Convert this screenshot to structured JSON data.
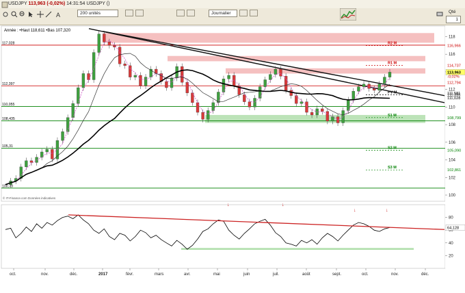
{
  "toolbar": {
    "symbol": "USDJPY",
    "last": "113,963",
    "change": "(-0,02%)",
    "time": "14:31:54",
    "symbol_suffix": "USDJPY ()",
    "units_label": "200 unités",
    "journal_label": "Journalier",
    "qty_label": "Qté",
    "qty_value": "1"
  },
  "legend": {
    "text": "Année : •Haut 118,611 •Bas 107,320"
  },
  "chart_data": {
    "type": "line",
    "subtype": "candlestick with moving averages, support/resistance zones, pivot levels and lower oscillator",
    "x_ticks": [
      "oct.",
      "nov.",
      "déc.",
      "2017",
      "févr.",
      "mars",
      "avr.",
      "mai",
      "juin",
      "juil.",
      "août",
      "sept.",
      "oct.",
      "nov.",
      "déc."
    ],
    "y_ticks": [
      100,
      102,
      104,
      106,
      108,
      110,
      112,
      114,
      116,
      118
    ],
    "ylim": [
      99.3,
      119.2
    ],
    "left_levels": [
      {
        "label": "117,028",
        "value": 117.03,
        "color": "#cc0000"
      },
      {
        "label": "112,397",
        "value": 112.4,
        "color": "#cc0000"
      },
      {
        "label": "110,055",
        "value": 110.06,
        "color": "#008000"
      },
      {
        "label": "108,435",
        "value": 108.44,
        "color": "#008000"
      },
      {
        "label": "105,31",
        "value": 105.31,
        "color": "#008000"
      },
      {
        "label": "100,79",
        "value": 100.79,
        "color": "#008000"
      }
    ],
    "right_labels": [
      {
        "label": "116,966",
        "value": 116.97,
        "color": "#cc0000"
      },
      {
        "label": "114,737",
        "value": 114.74,
        "color": "#cc0000"
      },
      {
        "label": "113,963",
        "value": 113.96,
        "color": "#000000",
        "box": "#ffff66"
      },
      {
        "label": "-0,02%",
        "value": 113.5,
        "color": "#cc0000"
      },
      {
        "label": "112,794",
        "value": 112.79,
        "color": "#cc0000"
      },
      {
        "label": "111,581",
        "value": 111.58,
        "color": "#000000"
      },
      {
        "label": "111,395",
        "value": 111.4,
        "color": "#000000"
      },
      {
        "label": "111,028",
        "value": 111.03,
        "color": "#000000"
      },
      {
        "label": "108,799",
        "value": 108.8,
        "color": "#008000"
      },
      {
        "label": "105,090",
        "value": 105.09,
        "color": "#008000"
      },
      {
        "label": "102,861",
        "value": 102.86,
        "color": "#008000"
      }
    ],
    "pivots": [
      {
        "label": "R2 M",
        "value": 116.97,
        "color": "#cc0000"
      },
      {
        "label": "R1 M",
        "value": 114.74,
        "color": "#cc0000"
      },
      {
        "label": "PV M",
        "value": 111.4,
        "color": "#000000"
      },
      {
        "label": "S1 M",
        "value": 108.8,
        "color": "#008000"
      },
      {
        "label": "S2 M",
        "value": 105.09,
        "color": "#008000"
      },
      {
        "label": "S3 M",
        "value": 102.86,
        "color": "#008000"
      }
    ],
    "zones": [
      {
        "from": 117.3,
        "to": 118.4,
        "color": "#f4b9b9"
      },
      {
        "from": 115.2,
        "to": 115.8,
        "color": "#f4b9b9"
      },
      {
        "from": 113.8,
        "to": 114.4,
        "color": "#f4b9b9"
      },
      {
        "from": 108.2,
        "to": 109.1,
        "color": "#b5e0b0"
      }
    ],
    "price": [
      101.2,
      101.6,
      101.9,
      103.2,
      103.9,
      103.7,
      104.3,
      104.9,
      105.2,
      104.1,
      106.2,
      107.2,
      108.8,
      110.4,
      112.2,
      113.8,
      113.1,
      116.2,
      118.3,
      117.4,
      117.0,
      116.8,
      114.9,
      114.7,
      113.4,
      113.6,
      112.4,
      113.4,
      114.3,
      113.8,
      112.9,
      112.2,
      113.3,
      114.6,
      112.8,
      111.6,
      110.5,
      109.4,
      108.6,
      109.6,
      110.5,
      111.7,
      113.2,
      113.6,
      112.4,
      111.4,
      110.6,
      110.0,
      111.0,
      112.3,
      113.1,
      113.7,
      114.3,
      113.5,
      111.9,
      111.3,
      110.4,
      110.6,
      109.4,
      109.1,
      109.8,
      109.5,
      108.4,
      108.9,
      108.2,
      109.6,
      110.8,
      111.8,
      112.3,
      112.6,
      112.1,
      111.9,
      112.6,
      113.4,
      113.96
    ],
    "oscillator_ticks": [
      20,
      40,
      60,
      80
    ],
    "oscillator_label": "64,128",
    "oscillator": [
      61,
      63,
      48,
      55,
      65,
      58,
      70,
      63,
      72,
      68,
      75,
      80,
      82,
      78,
      84,
      76,
      70,
      60,
      55,
      62,
      50,
      45,
      55,
      52,
      43,
      50,
      60,
      56,
      48,
      52,
      45,
      40,
      35,
      44,
      38,
      30,
      36,
      46,
      58,
      62,
      70,
      76,
      74,
      60,
      52,
      46,
      55,
      62,
      70,
      74,
      77,
      68,
      56,
      50,
      40,
      38,
      35,
      44,
      40,
      45,
      38,
      48,
      55,
      50,
      43,
      52,
      60,
      68,
      72,
      70,
      66,
      60,
      58,
      62,
      64.128
    ],
    "source_note": "© IT-Finance.com Données indicatives"
  }
}
